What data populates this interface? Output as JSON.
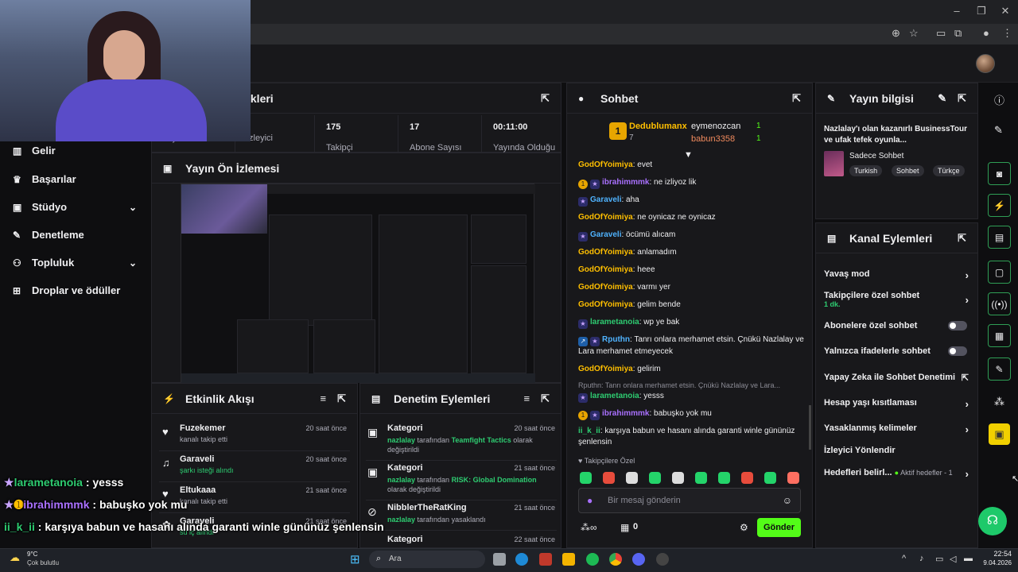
{
  "stats": {
    "title_partial": "ikleri",
    "cells": [
      {
        "value": "",
        "label": "Yayın"
      },
      {
        "value": "",
        "label": "İzleyici"
      },
      {
        "value": "175",
        "label": "Takipçi"
      },
      {
        "value": "17",
        "label": "Abone Sayısı"
      },
      {
        "value": "00:11:00",
        "label": "Yayında Olduğu"
      }
    ]
  },
  "sidebar": {
    "items": [
      {
        "label": "Gelir",
        "icon": "chart-icon"
      },
      {
        "label": "Başarılar",
        "icon": "trophy-icon"
      },
      {
        "label": "Stüdyo",
        "icon": "studio-icon"
      },
      {
        "label": "Denetleme",
        "icon": "wrench-icon"
      },
      {
        "label": "Topluluk",
        "icon": "community-icon"
      },
      {
        "label": "Droplar ve ödüller",
        "icon": "drops-icon"
      }
    ]
  },
  "preview": {
    "title": "Yayın Ön İzlemesi"
  },
  "chat": {
    "title": "Sohbet",
    "top_gifter": {
      "name": "Dedublumanx",
      "count": "7"
    },
    "gifters": [
      {
        "name": "eymenozcan",
        "count": "1"
      },
      {
        "name": "babun3358",
        "count": "1"
      }
    ],
    "messages": [
      {
        "user": "GodOfYoimiya",
        "text": ": evet"
      },
      {
        "user": "ibrahimmmk",
        "text": ": ne izliyoz lik"
      },
      {
        "user": "Garaveli",
        "text": ": aha"
      },
      {
        "user": "GodOfYoimiya",
        "text": ": ne oynicaz ne oynicaz"
      },
      {
        "user": "Garaveli",
        "text": ": öcümü alıcam"
      },
      {
        "user": "GodOfYoimiya",
        "text": ": anlamadım"
      },
      {
        "user": "GodOfYoimiya",
        "text": ": heee"
      },
      {
        "user": "GodOfYoimiya",
        "text": ": varmı yer"
      },
      {
        "user": "GodOfYoimiya",
        "text": ": gelim bende"
      },
      {
        "user": "larametanoia",
        "text": ": wp ye bak"
      },
      {
        "user": "Rputhn",
        "text": ": Tanrı onlara merhamet etsin. Çnükü Nazlalay ve Lara merhamet etmeyecek"
      },
      {
        "user": "GodOfYoimiya",
        "text": ": gelirim"
      },
      {
        "user": "larametanoia",
        "text": ": yesss"
      },
      {
        "user": "ibrahimmmk",
        "text": ": babuşko yok mu"
      },
      {
        "user": "ii_k_ii",
        "text": ": karşıya babun ve hasanı alında garanti winle gününüz şenlensin"
      }
    ],
    "reply_preview": "Rputhn: Tanrı onlara merhamet etsin. Çnükü Nazlalay ve Lara...",
    "followers_only": "Takipçilere Özel",
    "input_placeholder": "Bir mesaj gönderin",
    "points": "0",
    "send_label": "Gönder"
  },
  "stream_info": {
    "title": "Yayın bilgisi",
    "stream_title": "Nazlalay'ı olan kazanırlı BusinessTour ve ufak tefek oyunla...",
    "category": "Sadece Sohbet",
    "tags": [
      "Turkish",
      "Sohbet",
      "Türkçe"
    ]
  },
  "channel_actions": {
    "title": "Kanal Eylemleri",
    "rows": [
      {
        "label": "Yavaş mod",
        "sub": ""
      },
      {
        "label": "Takipçilere özel sohbet",
        "sub": "1 dk."
      },
      {
        "label": "Abonelere özel sohbet",
        "sub": ""
      },
      {
        "label": "Yalnızca ifadelerle sohbet",
        "sub": ""
      },
      {
        "label": "Yapay Zeka ile Sohbet Denetimi",
        "sub": ""
      },
      {
        "label": "Hesap yaşı kısıtlaması",
        "sub": ""
      },
      {
        "label": "Yasaklanmış kelimeler",
        "sub": ""
      },
      {
        "label": "İzleyici Yönlendir",
        "sub": ""
      },
      {
        "label": "Hedefleri belirl...",
        "sub": "Aktif hedefler - 1"
      }
    ]
  },
  "activity": {
    "title": "Etkinlik Akışı",
    "rows": [
      {
        "name": "Fuzekemer",
        "sub": "kanalı takip etti",
        "time": "20 saat önce"
      },
      {
        "name": "Garaveli",
        "sub": "şarkı isteği alındı",
        "time": "20 saat önce"
      },
      {
        "name": "Eltukaaa",
        "sub": "kanalı takip etti",
        "time": "21 saat önce"
      },
      {
        "name": "Garaveli",
        "sub": "su iç alındı",
        "time": "21 saat önce"
      }
    ]
  },
  "mod_actions": {
    "title": "Denetim Eylemleri",
    "rows": [
      {
        "name": "Kategori",
        "user": "nazlalay",
        "mid": " tarafından ",
        "hl": "Teamfight Tactics",
        "end": " olarak değiştirildi",
        "time": "20 saat önce"
      },
      {
        "name": "Kategori",
        "user": "nazlalay",
        "mid": " tarafından ",
        "hl": "RISK: Global Domination",
        "end": " olarak değiştirildi",
        "time": "21 saat önce"
      },
      {
        "name": "NibblerTheRatKing",
        "user": "nazlalay",
        "mid": " tarafından yasaklandı",
        "hl": "",
        "end": "",
        "time": "21 saat önce"
      },
      {
        "name": "Kategori",
        "user": "",
        "mid": "",
        "hl": "",
        "end": "",
        "time": "22 saat önce"
      }
    ]
  },
  "overlay_chat": [
    {
      "user": "larametanoia",
      "text": " : yesss"
    },
    {
      "user": "ibrahimmmk",
      "text": " : babuşko yok mu"
    },
    {
      "user": "ii_k_ii",
      "text": " : karşıya babun ve hasanı alında garanti winle gününüz şenlensin"
    }
  ],
  "taskbar": {
    "weather_temp": "9°C",
    "weather_desc": "Çok bulutlu",
    "search_placeholder": "Ara",
    "time": "22:54",
    "date": "9.04.2026"
  },
  "colors": {
    "accent": "#53fc18",
    "bg": "#0e0e10",
    "panel": "#18181b"
  }
}
